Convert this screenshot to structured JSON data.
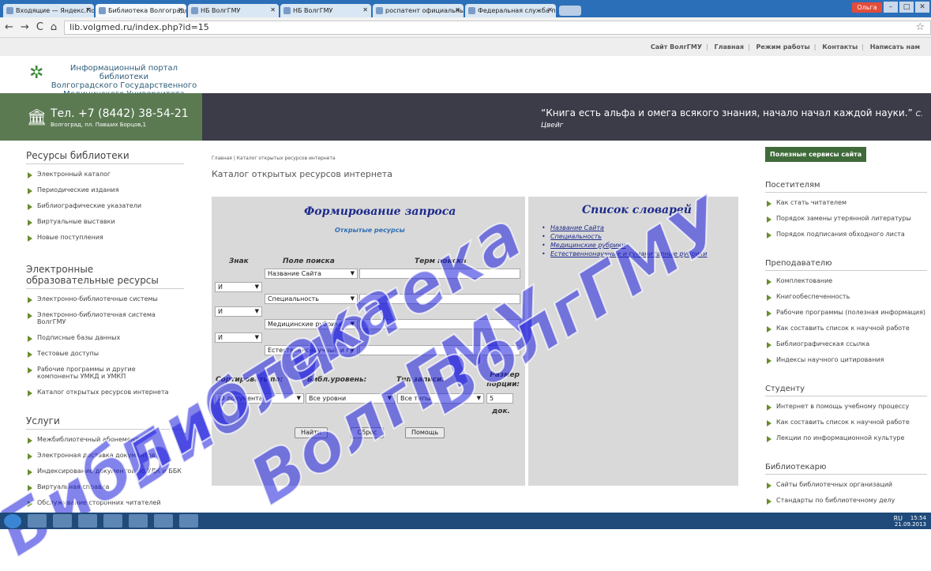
{
  "browser": {
    "tabs": [
      {
        "label": "Входящие — Яндекс.Поч"
      },
      {
        "label": "Библиотека Волгоградс"
      },
      {
        "label": "НБ ВолгГМУ"
      },
      {
        "label": "НБ ВолгГМУ"
      },
      {
        "label": "роспатент официальны"
      },
      {
        "label": "Федеральная служба по"
      }
    ],
    "user_label": "Ольга",
    "url": "lib.volgmed.ru/index.php?id=15"
  },
  "topnav": [
    "Сайт ВолгГМУ",
    "Главная",
    "Режим работы",
    "Контакты",
    "Написать нам"
  ],
  "header": {
    "logo_line1": "Информационный портал библиотеки",
    "logo_line2": "Волгоградского Государственного",
    "logo_line3": "Медицинского Университета",
    "phone": "Тел. +7 (8442) 38-54-21",
    "address": "Волгоград, пл. Павших Борцов,1",
    "quote": "“Книга есть альфа и омега всякого знания, начало начал каждой науки.”",
    "quote_author": "С. Цвейг"
  },
  "left": {
    "s1_title": "Ресурсы библиотеки",
    "s1_items": [
      "Электронный каталог",
      "Периодические издания",
      "Библиографические указатели",
      "Виртуальные выставки",
      "Новые поступления"
    ],
    "s2_title": "Электронные образовательные ресурсы",
    "s2_items": [
      "Электронно-библиотечные системы",
      "Электронно-библиотечная система ВолгГМУ",
      "Подписные базы данных",
      "Тестовые доступы",
      "Рабочие программы и другие компоненты УМКД и УМКП",
      "Каталог открытых ресурсов интернета"
    ],
    "s3_title": "Услуги",
    "s3_items": [
      "Межбиблиотечный абонемент",
      "Электронная доставка документов",
      "Индексирование документов по УДК и ББК",
      "Виртуальная справка",
      "Обслуживание сторонних читателей"
    ]
  },
  "main": {
    "breadcrumb": "Главная | Каталог открытых ресурсов интернета",
    "title": "Каталог открытых ресурсов интернета",
    "form_title": "Формирование запроса",
    "form_sub": "Открытые ресурсы",
    "col_sign": "Знак",
    "col_field": "Поле поиска",
    "col_term": "Терм поиска",
    "fields": [
      "Название Сайта",
      "Специальность",
      "Медицинские рубрики",
      "Естественнонаучные и гу"
    ],
    "ops": [
      "И",
      "И",
      "И"
    ],
    "sort_label": "Сортировать по:",
    "level_label": "Библ.уровень:",
    "type_label": "Тип записи:",
    "size_label": "Размер порции:",
    "sort_value": "ID документа",
    "level_value": "Все уровни",
    "type_value": "Все типы",
    "size_value": "5",
    "size_unit": "док.",
    "btn_find": "Найти",
    "btn_reset": "Сброс",
    "btn_help": "Помощь",
    "dict_title": "Список словарей",
    "dicts": [
      "Название Сайта",
      "Специальность",
      "Медицинские рубрики",
      "Естественнонаучные и гуманитарные рубрики"
    ]
  },
  "right": {
    "services_btn": "Полезные сервисы сайта",
    "r1_title": "Посетителям",
    "r1_items": [
      "Как стать читателем",
      "Порядок замены утерянной литературы",
      "Порядок подписания обходного листа"
    ],
    "r2_title": "Преподавателю",
    "r2_items": [
      "Комплектование",
      "Книгообеспеченность",
      "Рабочие программы (полезная информация)",
      "Как составить список к научной работе",
      "Библиографическая ссылка",
      "Индексы научного цитирования"
    ],
    "r3_title": "Студенту",
    "r3_items": [
      "Интернет в помощь учебному процессу",
      "Как составить список к научной работе",
      "Лекции по информационной культуре"
    ],
    "r4_title": "Библиотекарю",
    "r4_items": [
      "Сайты библиотечных организаций",
      "Стандарты по библиотечному делу"
    ]
  },
  "watermark": {
    "w1": "Библиотека",
    "w2": "ВолгГМУ",
    "w3": "Библиотека",
    "w4": "ВолгГМУ"
  },
  "taskbar": {
    "lang": "RU",
    "time": "15:54",
    "date": "21.09.2013"
  }
}
